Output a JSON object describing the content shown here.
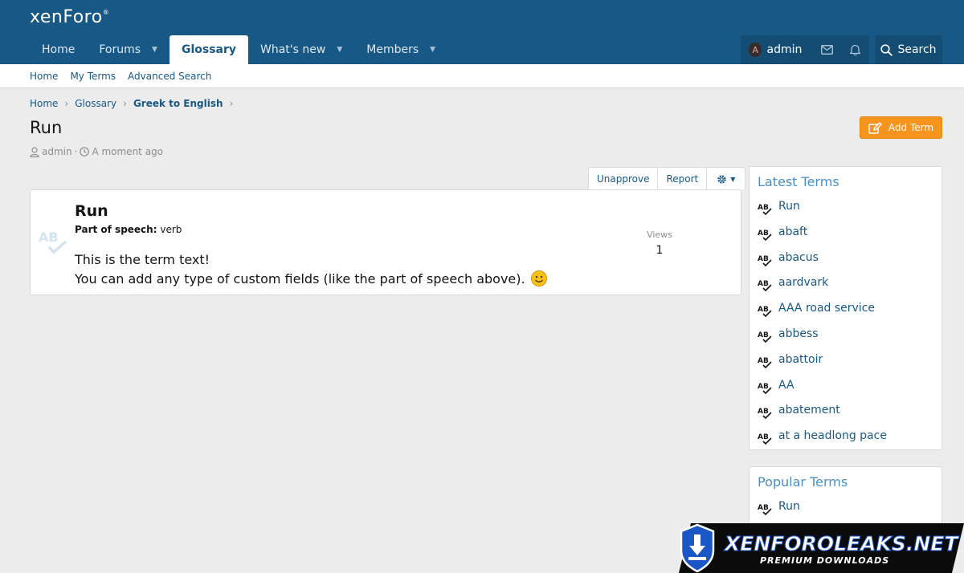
{
  "header": {
    "logo": "xenForo",
    "logo_mark": "®",
    "nav": [
      {
        "label": "Home",
        "active": false,
        "dropdown": false
      },
      {
        "label": "Forums",
        "active": false,
        "dropdown": true
      },
      {
        "label": "Glossary",
        "active": true,
        "dropdown": false
      },
      {
        "label": "What's new",
        "active": false,
        "dropdown": true
      },
      {
        "label": "Members",
        "active": false,
        "dropdown": true
      }
    ],
    "user": {
      "avatar_letter": "A",
      "name": "admin"
    },
    "search_label": "Search"
  },
  "subnav": [
    "Home",
    "My Terms",
    "Advanced Search"
  ],
  "breadcrumb": {
    "items": [
      "Home",
      "Glossary"
    ],
    "current": "Greek to English"
  },
  "page": {
    "title": "Run",
    "author": "admin",
    "time": "A moment ago",
    "separator": "·",
    "add_term_label": "Add Term"
  },
  "actions": [
    "Unapprove",
    "Report"
  ],
  "term": {
    "title": "Run",
    "pos_label": "Part of speech:",
    "pos_value": "verb",
    "text_line1": "This is the term text!",
    "text_line2": "You can add any type of custom fields (like the part of speech above).",
    "views_label": "Views",
    "views_value": "1"
  },
  "sidebar": {
    "latest_title": "Latest Terms",
    "latest": [
      "Run",
      "abaft",
      "abacus",
      "aardvark",
      "AAA road service",
      "abbess",
      "abattoir",
      "AA",
      "abatement",
      "at a headlong pace"
    ],
    "popular_title": "Popular Terms",
    "popular": [
      "Run"
    ]
  },
  "watermark": {
    "main": "XENFOROLEAKS.NET",
    "sub": "PREMIUM DOWNLOADS"
  },
  "colors": {
    "header": "#185886",
    "accent": "#f7941d",
    "link": "#185886",
    "sidebar_title": "#4a90c2"
  }
}
